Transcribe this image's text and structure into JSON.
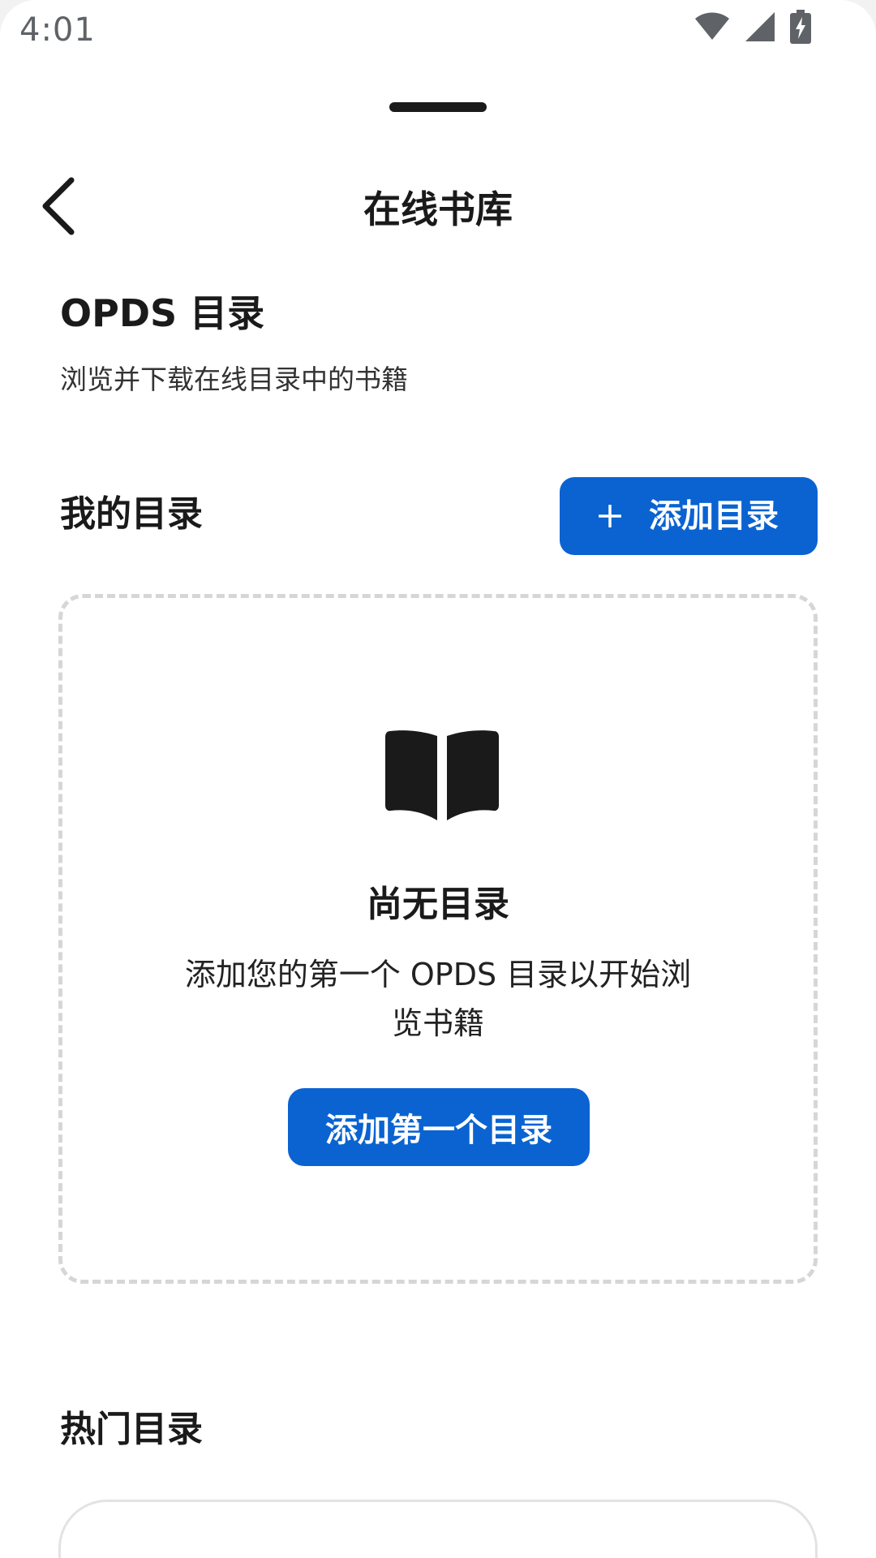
{
  "status_bar": {
    "time": "4:01",
    "icons": [
      "wifi-icon",
      "signal-icon",
      "battery-charging-icon"
    ]
  },
  "header": {
    "title": "在线书库",
    "back_icon": "chevron-left-icon"
  },
  "intro": {
    "title": "OPDS 目录",
    "subtitle": "浏览并下载在线目录中的书籍"
  },
  "my_catalogs": {
    "label": "我的目录",
    "add_button_icon": "plus-icon",
    "add_button_label": "添加目录"
  },
  "empty_state": {
    "icon": "open-book-icon",
    "title": "尚无目录",
    "description": "添加您的第一个 OPDS 目录以开始浏览书籍",
    "button_label": "添加第一个目录"
  },
  "popular": {
    "label": "热门目录"
  },
  "colors": {
    "accent": "#0a63d1",
    "text": "#1a1a1a",
    "dashed_border": "#d6d6d6"
  }
}
